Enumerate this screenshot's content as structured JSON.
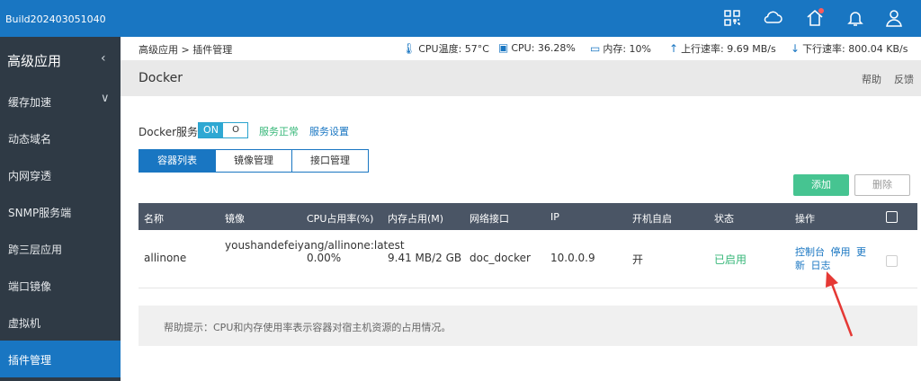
{
  "topbar": {
    "build": "Build202403051040",
    "icons": [
      "apps-grid-icon",
      "cloud-icon",
      "home-alert-icon",
      "bell-icon",
      "user-icon"
    ]
  },
  "sidebar": {
    "header": "高级应用",
    "items": [
      {
        "label": "缓存加速",
        "expandable": true,
        "active": false
      },
      {
        "label": "动态域名",
        "active": false
      },
      {
        "label": "内网穿透",
        "active": false
      },
      {
        "label": "SNMP服务端",
        "active": false
      },
      {
        "label": "跨三层应用",
        "active": false
      },
      {
        "label": "端口镜像",
        "active": false
      },
      {
        "label": "虚拟机",
        "active": false
      },
      {
        "label": "插件管理",
        "active": true
      }
    ]
  },
  "breadcrumb": "高级应用 > 插件管理",
  "stats": {
    "cpu_temp": "CPU温度: 57°C",
    "cpu": "CPU: 36.28%",
    "mem": "内存: 10%",
    "up": "上行速率: 9.69 MB/s",
    "down": "下行速率: 800.04 KB/s"
  },
  "page": {
    "title": "Docker",
    "help": "帮助",
    "feedback": "反馈"
  },
  "service": {
    "label": "Docker服务",
    "on": "ON",
    "off": "O",
    "status": "服务正常",
    "settings": "服务设置"
  },
  "tabs": [
    "容器列表",
    "镜像管理",
    "接口管理"
  ],
  "actions": {
    "add": "添加",
    "delete": "删除"
  },
  "table": {
    "headers": [
      "名称",
      "镜像",
      "CPU占用率(%)",
      "内存占用(M)",
      "网络接口",
      "IP",
      "开机自启",
      "状态",
      "操作"
    ],
    "rows": [
      {
        "name": "allinone",
        "image": "youshandefeiyang/allinone:latest",
        "cpu": "0.00%",
        "mem": "9.41 MB/2 GB",
        "iface": "doc_docker",
        "ip": "10.0.0.9",
        "autostart": "开",
        "status": "已启用",
        "ops": [
          "控制台",
          "停用",
          "更新",
          "日志"
        ]
      }
    ]
  },
  "help_tip": "帮助提示：CPU和内存使用率表示容器对宿主机资源的占用情况。",
  "colors": {
    "brand": "#1976c2",
    "sidebar": "#2f3a45",
    "success": "#37b779",
    "annotation": "#e53935"
  }
}
